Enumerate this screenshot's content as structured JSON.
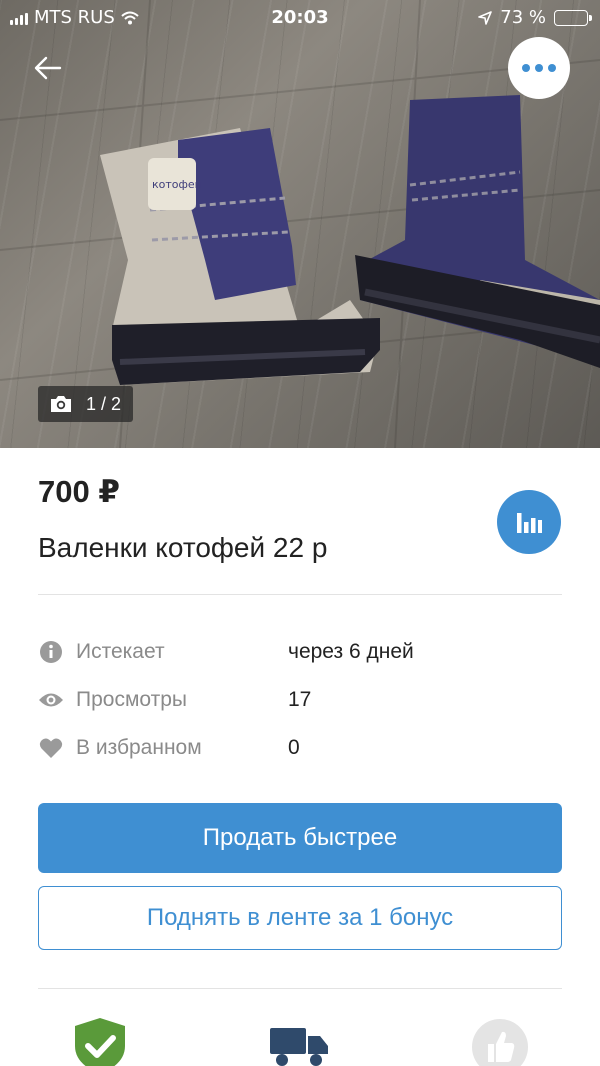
{
  "status_bar": {
    "carrier": "MTS RUS",
    "time": "20:03",
    "battery": "73 %",
    "battery_level": 0.73
  },
  "gallery": {
    "counter": "1 / 2"
  },
  "listing": {
    "price": "700 ₽",
    "title": "Валенки котофей 22 р"
  },
  "details": [
    {
      "icon": "info-icon",
      "label": "Истекает",
      "value": "через 6 дней"
    },
    {
      "icon": "eye-icon",
      "label": "Просмотры",
      "value": "17"
    },
    {
      "icon": "heart-icon",
      "label": "В избранном",
      "value": "0"
    }
  ],
  "actions": {
    "sell_faster": "Продать быстрее",
    "raise_in_feed": "Поднять в ленте за 1 бонус"
  },
  "badges": [
    {
      "icon": "shield-check-icon"
    },
    {
      "icon": "delivery-truck-icon"
    },
    {
      "icon": "thumbs-up-icon"
    }
  ],
  "colors": {
    "accent": "#3f8fd2",
    "shield": "#5a9a3a",
    "truck": "#2f4a6b",
    "thumb": "#e4e4e4"
  }
}
